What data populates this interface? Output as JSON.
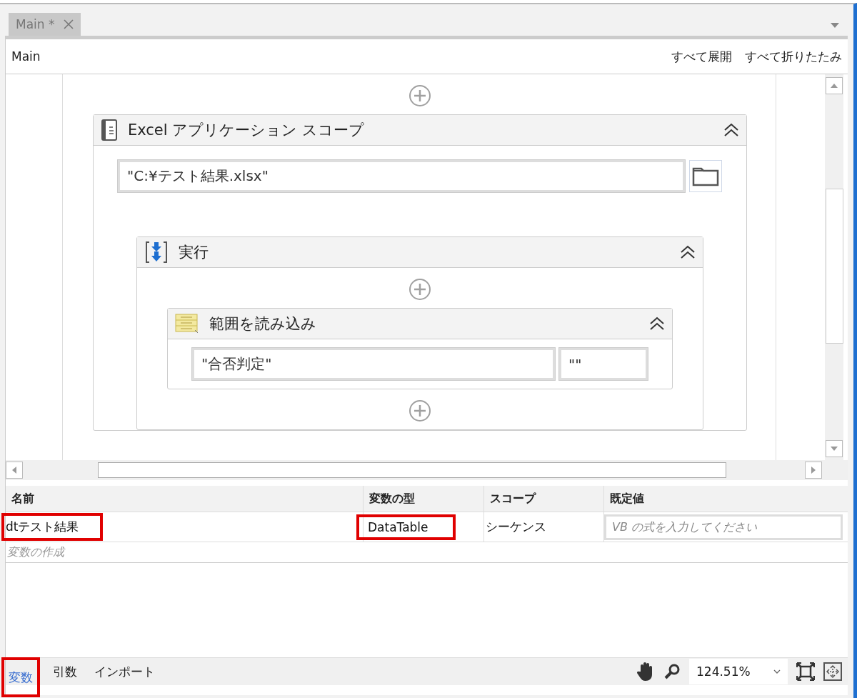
{
  "tabs": [
    {
      "label": "Main *",
      "selected": true,
      "closable": true
    }
  ],
  "breadcrumb": "Main",
  "header_links": [
    "すべて展開",
    "すべて折りたたみ"
  ],
  "designer": {
    "scope": {
      "title": "Excel アプリケーション スコープ",
      "expanded": true,
      "path": "\"C:¥テスト結果.xlsx\"",
      "sequence": {
        "title": "実行",
        "expanded": true,
        "activity": {
          "title": "範囲を読み込み",
          "expanded": true,
          "sheet": "\"合否判定\"",
          "range": "\"\""
        }
      }
    }
  },
  "variables": {
    "columns": [
      "名前",
      "変数の型",
      "スコープ",
      "既定値"
    ],
    "rows": [
      {
        "name": {
          "text": "dtテスト結果",
          "highlighted": true
        },
        "type": {
          "text": "DataTable",
          "highlighted": true
        },
        "scope": {
          "text": "シーケンス",
          "highlighted": false
        },
        "default": {
          "placeholder": "VB の式を入力してください",
          "highlighted": false
        }
      }
    ],
    "create_placeholder": "変数の作成"
  },
  "bottom_tabs": [
    {
      "label": "変数",
      "selected": true,
      "highlighted": true
    },
    {
      "label": "引数",
      "selected": false,
      "highlighted": false
    },
    {
      "label": "インポート",
      "selected": false,
      "highlighted": false
    }
  ],
  "zoom": "124.51%"
}
